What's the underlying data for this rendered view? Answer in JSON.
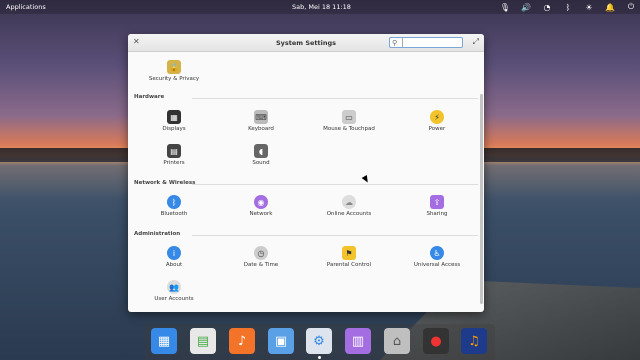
{
  "panel": {
    "applications": "Applications",
    "clock": "Sab, Mei 18    11:18"
  },
  "window": {
    "title": "System Settings",
    "search_placeholder": "",
    "sections": [
      {
        "title": "",
        "items": [
          {
            "label": "Security & Privacy"
          }
        ]
      },
      {
        "title": "Hardware",
        "items": [
          {
            "label": "Displays"
          },
          {
            "label": "Keyboard"
          },
          {
            "label": "Mouse & Touchpad"
          },
          {
            "label": "Power"
          },
          {
            "label": "Printers"
          },
          {
            "label": "Sound"
          }
        ]
      },
      {
        "title": "Network & Wireless",
        "items": [
          {
            "label": "Bluetooth"
          },
          {
            "label": "Network"
          },
          {
            "label": "Online Accounts"
          },
          {
            "label": "Sharing"
          }
        ]
      },
      {
        "title": "Administration",
        "items": [
          {
            "label": "About"
          },
          {
            "label": "Date & Time"
          },
          {
            "label": "Parental Control"
          },
          {
            "label": "Universal Access"
          },
          {
            "label": "User Accounts"
          }
        ]
      }
    ]
  },
  "dock": {
    "icons": [
      "multitasking-view-icon",
      "calendar-icon",
      "music-icon",
      "photos-icon",
      "settings-icon",
      "app-center-icon",
      "files-icon",
      "screen-recorder-icon",
      "audacity-icon"
    ],
    "colors": {
      "accent": "#3689e6"
    }
  }
}
